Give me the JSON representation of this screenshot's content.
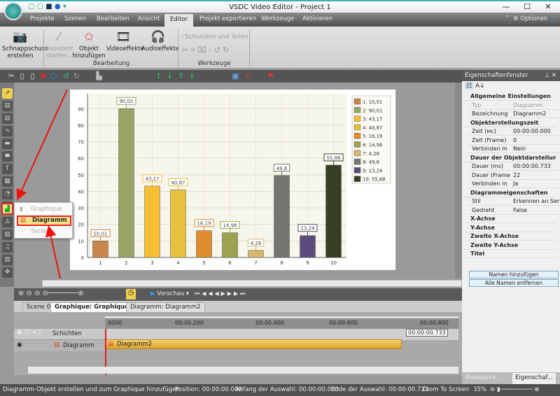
{
  "window": {
    "title": "VSDC Video Editor - Project 1",
    "minimize": "—",
    "maximize": "☐",
    "close": "✕"
  },
  "menu_tabs": [
    "Projekte",
    "Szenen",
    "Bearbeiten",
    "Ansicht",
    "Editor",
    "Projekt exportieren",
    "Werkzeuge",
    "Aktivieren"
  ],
  "active_tab": "Editor",
  "options_label": "Optionen",
  "ribbon": {
    "snapshot": "Schnappschuss erstellen",
    "assistant": "Assistent starten...",
    "add_object": "Objekt hinzufügen",
    "video_effects": "Videoeffekte",
    "audio_effects": "Audioeffekte",
    "group_edit": "Bearbeitung",
    "cut_split": "Schneiden und Teilen",
    "group_tools": "Werkzeuge"
  },
  "popup_menu": [
    {
      "label": "Graphique",
      "enabled": false
    },
    {
      "label": "Diagramm",
      "enabled": true,
      "highlighted": true
    },
    {
      "label": "Serie",
      "enabled": false
    }
  ],
  "chart_data": {
    "type": "bar",
    "categories": [
      "1",
      "2",
      "3",
      "4",
      "5",
      "6",
      "7",
      "8",
      "9",
      "10"
    ],
    "values": [
      10.01,
      90.01,
      43.17,
      40.87,
      16.19,
      14.98,
      4.28,
      49.6,
      13.24,
      55.88
    ],
    "data_labels": [
      "10,01",
      "90,01",
      "43,17",
      "40,87",
      "16,19",
      "14,98",
      "4,28",
      "49,6",
      "13,24",
      "55,88"
    ],
    "legend": [
      "1: 10,01",
      "2: 90,01",
      "3: 43,17",
      "4: 40,87",
      "5: 16,19",
      "6: 14,98",
      "7: 4,28",
      "8: 49,6",
      "9: 13,24",
      "10: 55,88"
    ],
    "colors": [
      "#c8864a",
      "#98a466",
      "#f4bf32",
      "#e6c23c",
      "#e08a2c",
      "#9ca250",
      "#d6b76c",
      "#72766e",
      "#5c4c7e",
      "#363f24"
    ],
    "yticks": [
      "0",
      "10",
      "20",
      "30",
      "40",
      "50",
      "60",
      "70",
      "80",
      "90"
    ],
    "ylim": [
      0,
      99
    ],
    "grid": true,
    "legend_position": "right",
    "title": "",
    "xlabel": "",
    "ylabel": ""
  },
  "properties": {
    "title": "Eigenschaftenfenster",
    "rows": [
      {
        "k": "Allgemeine Einstellungen",
        "sec": true
      },
      {
        "k": "Typ",
        "v": "Diagramm"
      },
      {
        "k": "Bezeichnung",
        "v": "Diagramm2"
      },
      {
        "k": "Objekterstellungszeit",
        "sec": true
      },
      {
        "k": "Zeit (мс)",
        "v": "00:00:00.000"
      },
      {
        "k": "Zeit (Frame)",
        "v": "0"
      },
      {
        "k": "Verbinden m",
        "v": "Nein"
      },
      {
        "k": "Dauer der Objektdarstellung",
        "sec": true
      },
      {
        "k": "Dauer (ms)",
        "v": "00:00:00.733"
      },
      {
        "k": "Dauer (Frame",
        "v": "22"
      },
      {
        "k": "Verbinden m",
        "v": "Ja"
      },
      {
        "k": "Diagrammeigenschaften",
        "sec": true
      },
      {
        "k": "Stil",
        "v": "Erkennen an Serie"
      },
      {
        "k": "Gedreht",
        "v": "False"
      },
      {
        "k": "X-Achse",
        "sec": true
      },
      {
        "k": "Y-Achse",
        "sec": true
      },
      {
        "k": "Zweite X-Achse",
        "sec": true
      },
      {
        "k": "Zweite Y-Achse",
        "sec": true
      },
      {
        "k": "Titel",
        "sec": true
      }
    ],
    "add_names": "Namen hinzufügen",
    "remove_names": "Alle Namen entfernen",
    "tab_resources": "Ressource...",
    "tab_properties": "Eigenschaf..."
  },
  "timeline": {
    "preview": "Vorschau",
    "tabs": [
      "Scene 0",
      "Graphique: Graphique2",
      "Diagramm: Diagramm2"
    ],
    "ruler": [
      "0000",
      "00:00.200",
      "00:00.400",
      "00:00.600",
      "00:00.800"
    ],
    "layers_label": "Schichten",
    "layer_name": "Diagramm",
    "clip_name": "Diagramm2",
    "end_marker": "00:00:00.733"
  },
  "status": {
    "hint": "Diagramm-Objekt erstellen und zum Graphique hinzufügen",
    "position": "Position:  00:00:00.000",
    "sel_start": "Anfang der Auswahl:  00:00:00.000",
    "sel_end": "Ende der Auswahl:  00:00:00.733",
    "zoom_to_screen": "Zoom To Screen",
    "zoom": "35%"
  }
}
